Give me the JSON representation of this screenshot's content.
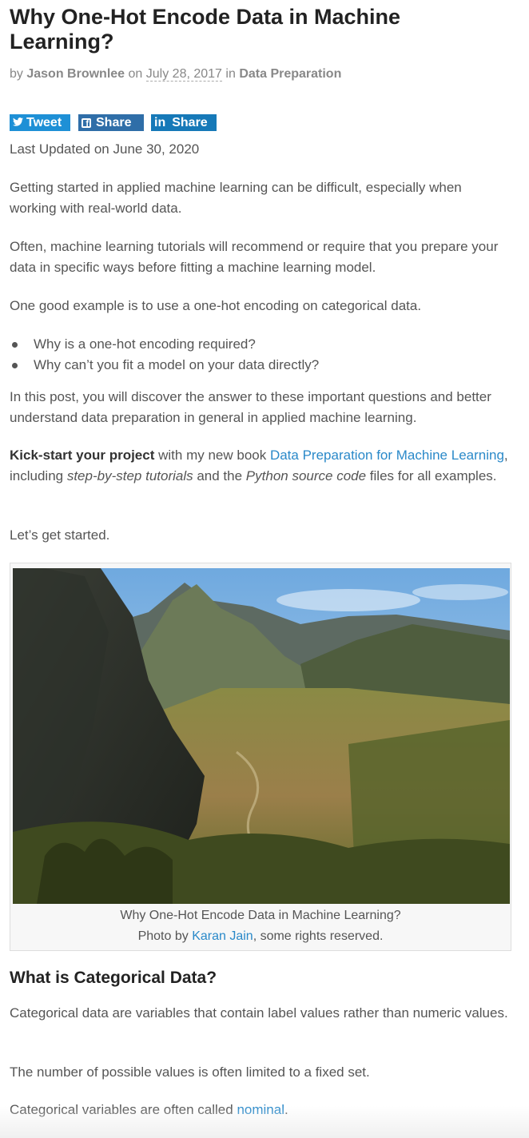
{
  "article": {
    "title": "Why One-Hot Encode Data in Machine Learning?",
    "byline": {
      "by": "by",
      "author": "Jason Brownlee",
      "on": "on",
      "date": "July 28, 2017",
      "in": "in",
      "category": "Data Preparation"
    },
    "social": {
      "tweet": "Tweet",
      "facebook_share": "Share",
      "linkedin_icon": "in",
      "linkedin_share": "Share"
    },
    "last_updated": "Last Updated on June 30, 2020",
    "para1": "Getting started in applied machine learning can be difficult, especially when working with real-world data.",
    "para2": "Often, machine learning tutorials will recommend or require that you prepare your data in specific ways before fitting a machine learning model.",
    "para3": "One good example is to use a one-hot encoding on categorical data.",
    "bullets": [
      "Why is a one-hot encoding required?",
      "Why can’t you fit a model on your data directly?"
    ],
    "para4": "In this post, you will discover the answer to these important questions and better understand data preparation in general in applied machine learning.",
    "kickstart": {
      "bold": "Kick-start your project",
      "text1": " with my new book ",
      "book_link": "Data Preparation for Machine Learning",
      "text2": ", including ",
      "em1": "step-by-step tutorials",
      "text3": " and the ",
      "em2": "Python source code",
      "text4": " files for all examples."
    },
    "para5": "Let’s get started.",
    "figure": {
      "caption_line1": "Why One-Hot Encode Data in Machine Learning?",
      "caption_prefix": "Photo by ",
      "photographer": "Karan Jain",
      "caption_suffix": ", some rights reserved."
    },
    "section_heading": "What is Categorical Data?",
    "para6": "Categorical data are variables that contain label values rather than numeric values.",
    "para7": "The number of possible values is often limited to a fixed set.",
    "para8": {
      "text": "Categorical variables are often called ",
      "link": "nominal",
      "end": "."
    }
  },
  "colors": {
    "link": "#2a89c9",
    "twitter": "#1e90d6",
    "facebook": "#2f6ea8",
    "linkedin": "#1679b8"
  }
}
